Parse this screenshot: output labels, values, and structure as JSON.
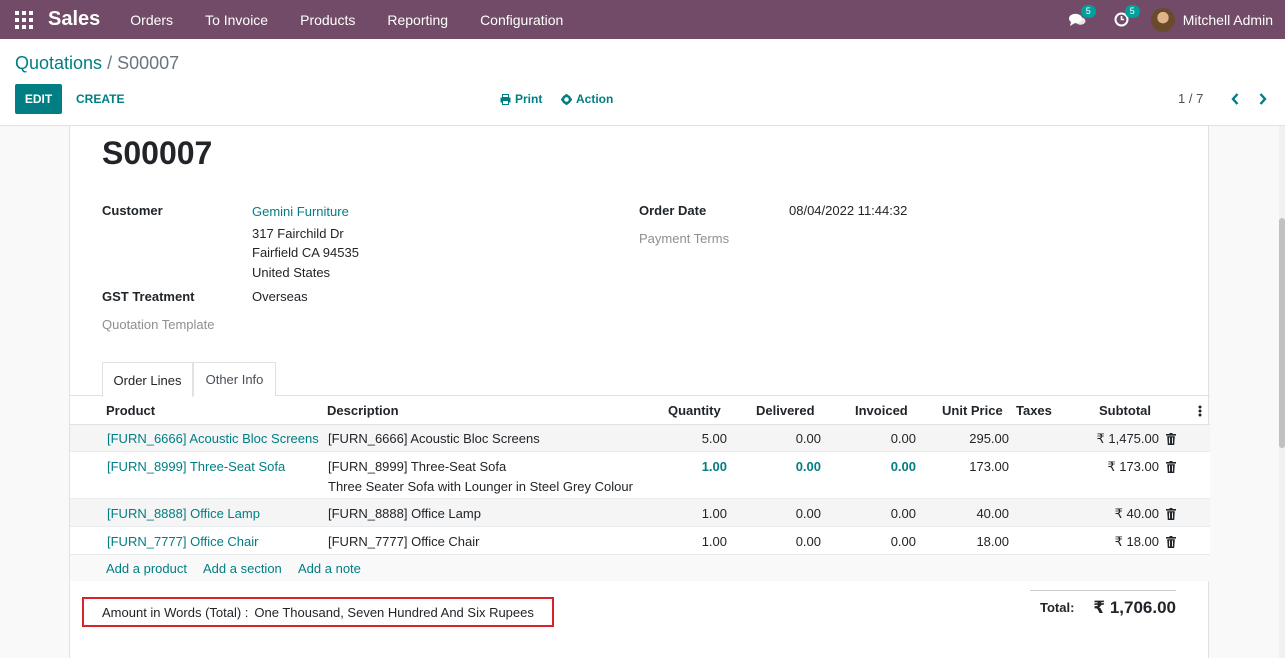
{
  "navbar": {
    "brand": "Sales",
    "menu": [
      "Orders",
      "To Invoice",
      "Products",
      "Reporting",
      "Configuration"
    ],
    "messages_badge": "5",
    "activities_badge": "5",
    "user_name": "Mitchell Admin"
  },
  "breadcrumb": {
    "parent": "Quotations",
    "separator": "/",
    "current": "S00007"
  },
  "toolbar": {
    "edit_label": "EDIT",
    "create_label": "CREATE",
    "print_label": "Print",
    "action_label": "Action",
    "pager": "1 / 7"
  },
  "form": {
    "order_name": "S00007",
    "customer_label": "Customer",
    "customer_name": "Gemini Furniture",
    "address_line1": "317 Fairchild Dr",
    "address_line2": "Fairfield CA 94535",
    "address_line3": "United States",
    "gst_label": "GST Treatment",
    "gst_value": "Overseas",
    "quotation_template_label": "Quotation Template",
    "order_date_label": "Order Date",
    "order_date_value": "08/04/2022 11:44:32",
    "payment_terms_label": "Payment Terms"
  },
  "tabs": [
    "Order Lines",
    "Other Info"
  ],
  "table": {
    "headers": {
      "product": "Product",
      "description": "Description",
      "quantity": "Quantity",
      "delivered": "Delivered",
      "invoiced": "Invoiced",
      "unit_price": "Unit Price",
      "taxes": "Taxes",
      "subtotal": "Subtotal"
    },
    "rows": [
      {
        "product": "[FURN_6666] Acoustic Bloc Screens",
        "description": "[FURN_6666] Acoustic Bloc Screens",
        "description2": "",
        "quantity": "5.00",
        "delivered": "0.00",
        "invoiced": "0.00",
        "unit_price": "295.00",
        "subtotal": "₹ 1,475.00"
      },
      {
        "product": "[FURN_8999] Three-Seat Sofa",
        "description": "[FURN_8999] Three-Seat Sofa",
        "description2": "Three Seater Sofa with Lounger in Steel Grey Colour",
        "quantity": "1.00",
        "delivered": "0.00",
        "invoiced": "0.00",
        "unit_price": "173.00",
        "subtotal": "₹ 173.00"
      },
      {
        "product": "[FURN_8888] Office Lamp",
        "description": "[FURN_8888] Office Lamp",
        "description2": "",
        "quantity": "1.00",
        "delivered": "0.00",
        "invoiced": "0.00",
        "unit_price": "40.00",
        "subtotal": "₹ 40.00"
      },
      {
        "product": "[FURN_7777] Office Chair",
        "description": "[FURN_7777] Office Chair",
        "description2": "",
        "quantity": "1.00",
        "delivered": "0.00",
        "invoiced": "0.00",
        "unit_price": "18.00",
        "subtotal": "₹ 18.00"
      }
    ],
    "add_product": "Add a product",
    "add_section": "Add a section",
    "add_note": "Add a note"
  },
  "footer": {
    "amount_words_label": "Amount in Words (Total) :",
    "amount_words_value": "One Thousand, Seven Hundred And Six Rupees",
    "total_label": "Total:",
    "total_value": "₹ 1,706.00"
  },
  "colors": {
    "navbar": "#714b67",
    "primary": "#017e84",
    "highlight_border": "#d9222a"
  }
}
